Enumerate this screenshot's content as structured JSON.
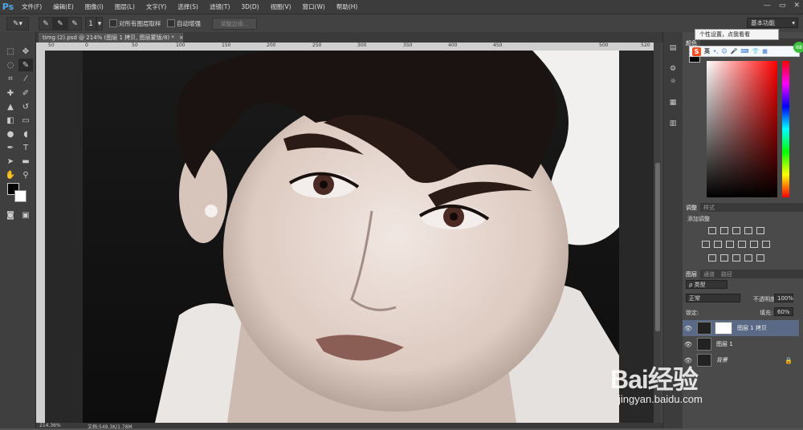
{
  "app": {
    "logo": "Ps"
  },
  "menu": [
    "文件(F)",
    "编辑(E)",
    "图像(I)",
    "图层(L)",
    "文字(Y)",
    "选择(S)",
    "滤镜(T)",
    "3D(D)",
    "视图(V)",
    "窗口(W)",
    "帮助(H)"
  ],
  "window_controls": [
    "—",
    "▭",
    "✕"
  ],
  "options": {
    "brush_size": "1",
    "sample_all_layers": "对所有图层取样",
    "auto_enhance": "自动增强",
    "refine_edge": "调整边缘...",
    "workspace": "基本功能"
  },
  "document": {
    "tab_title": "timg (2).psd @ 214% (图层 1 拷贝, 图层蒙版/8) *",
    "zoom": "214.36%",
    "doc_size": "文档:549.3K/1.78M"
  },
  "ruler_labels": [
    "50",
    "0",
    "50",
    "100",
    "150",
    "200",
    "250",
    "300",
    "350",
    "400",
    "450",
    "500",
    "520"
  ],
  "panels": {
    "color_tab": "颜色",
    "adjustments_tabs": [
      "调整",
      "样式"
    ],
    "adjustments_title": "添加调整",
    "layers_tabs": [
      "图层",
      "通道",
      "路径"
    ],
    "filter_kind": "ρ 类型",
    "blend_mode": "正常",
    "opacity_label": "不透明度:",
    "opacity_value": "100%",
    "lock_label": "锁定:",
    "fill_label": "填充:",
    "fill_value": "60%",
    "layers": [
      {
        "name": "图层 1 拷贝",
        "selected": true
      },
      {
        "name": "图层 1",
        "selected": false
      },
      {
        "name": "背景",
        "selected": false
      }
    ]
  },
  "tooltip": "个性设置，点我看看",
  "ime": {
    "logo": "S",
    "lang": "英",
    "badge": "68"
  },
  "watermark": {
    "brand": "Bai经验",
    "url": "jingyan.baidu.com"
  }
}
